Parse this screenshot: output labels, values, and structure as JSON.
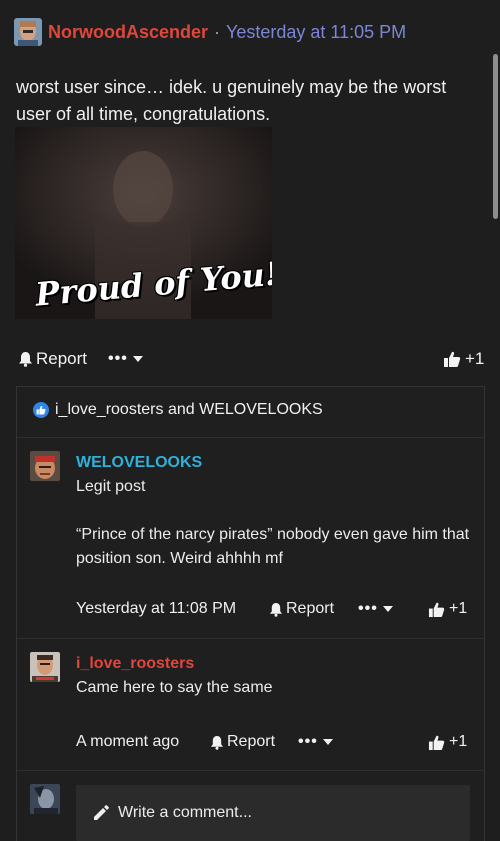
{
  "post": {
    "author": "NorwoodAscender",
    "separator": "·",
    "timestamp": "Yesterday at 11:05 PM",
    "body": "worst user since… idek. u genuinely may be the worst user of all time, congratulations.",
    "image": {
      "caption": "Proud of You!"
    },
    "actions": {
      "report": "Report",
      "more": "•••",
      "like_count": "+1"
    }
  },
  "reactions": {
    "text": "i_love_roosters and WELOVELOOKS"
  },
  "comments": [
    {
      "author": "WELOVELOOKS",
      "author_color": "#2fb1d9",
      "lines": [
        "Legit post",
        "“Prince of the narcy pirates” nobody even gave him that position son. Weird ahhhh mf"
      ],
      "time": "Yesterday at 11:08 PM",
      "report": "Report",
      "more": "•••",
      "like_count": "+1"
    },
    {
      "author": "i_love_roosters",
      "author_color": "#e0463c",
      "lines": [
        "Came here to say the same"
      ],
      "time": "A moment ago",
      "report": "Report",
      "more": "•••",
      "like_count": "+1"
    }
  ],
  "composer": {
    "placeholder": "Write a comment..."
  },
  "icons": {
    "report": "bell-icon",
    "more": "more-dots-icon",
    "caret": "caret-down-icon",
    "like": "thumbs-up-icon",
    "composer": "pencil-icon"
  },
  "colors": {
    "background": "#1e1e1f",
    "author_red": "#e0463c",
    "timestamp_blue": "#7d86d6",
    "like_blue": "#2f86e6"
  }
}
